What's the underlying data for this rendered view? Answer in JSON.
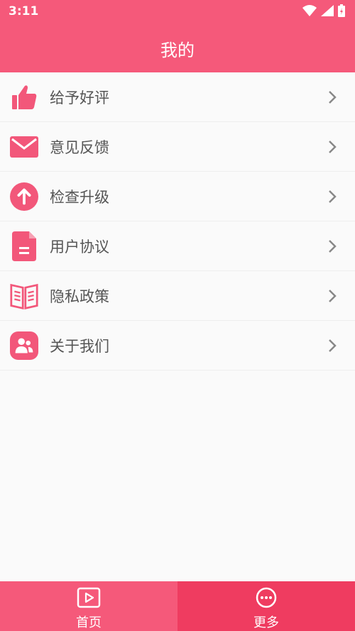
{
  "status_bar": {
    "time": "3:11"
  },
  "header": {
    "title": "我的"
  },
  "menu": {
    "items": [
      {
        "label": "给予好评",
        "icon": "thumbs-up-icon"
      },
      {
        "label": "意见反馈",
        "icon": "mail-icon"
      },
      {
        "label": "检查升级",
        "icon": "upgrade-arrow-icon"
      },
      {
        "label": "用户协议",
        "icon": "document-icon"
      },
      {
        "label": "隐私政策",
        "icon": "book-icon"
      },
      {
        "label": "关于我们",
        "icon": "people-icon"
      }
    ]
  },
  "tab_bar": {
    "tabs": [
      {
        "label": "首页",
        "icon": "play-video-icon"
      },
      {
        "label": "更多",
        "icon": "more-dots-icon"
      }
    ]
  },
  "colors": {
    "accent": "#f5597a",
    "accent_dark": "#ef3c60",
    "icon": "#f2577a"
  }
}
